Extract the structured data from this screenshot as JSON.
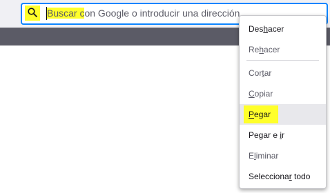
{
  "urlbar": {
    "placeholder_highlighted": "Buscar c",
    "placeholder_rest": "on Google o introducir una dirección"
  },
  "context_menu": {
    "items": [
      {
        "pre": "Des",
        "key": "h",
        "post": "acer"
      },
      {
        "pre": "Re",
        "key": "h",
        "post": "acer"
      },
      {
        "pre": "Cor",
        "key": "t",
        "post": "ar"
      },
      {
        "pre": "",
        "key": "C",
        "post": "opiar"
      },
      {
        "pre": "",
        "key": "P",
        "post": "egar"
      },
      {
        "pre": "Pegar e ",
        "key": "i",
        "post": "r"
      },
      {
        "pre": "E",
        "key": "l",
        "post": "iminar"
      },
      {
        "pre": "Selecciona",
        "key": "r",
        "post": " todo"
      }
    ]
  },
  "colors": {
    "highlight": "#ffff2a",
    "focus_ring": "#0a84ff"
  },
  "icons": {
    "search": "search-icon"
  }
}
